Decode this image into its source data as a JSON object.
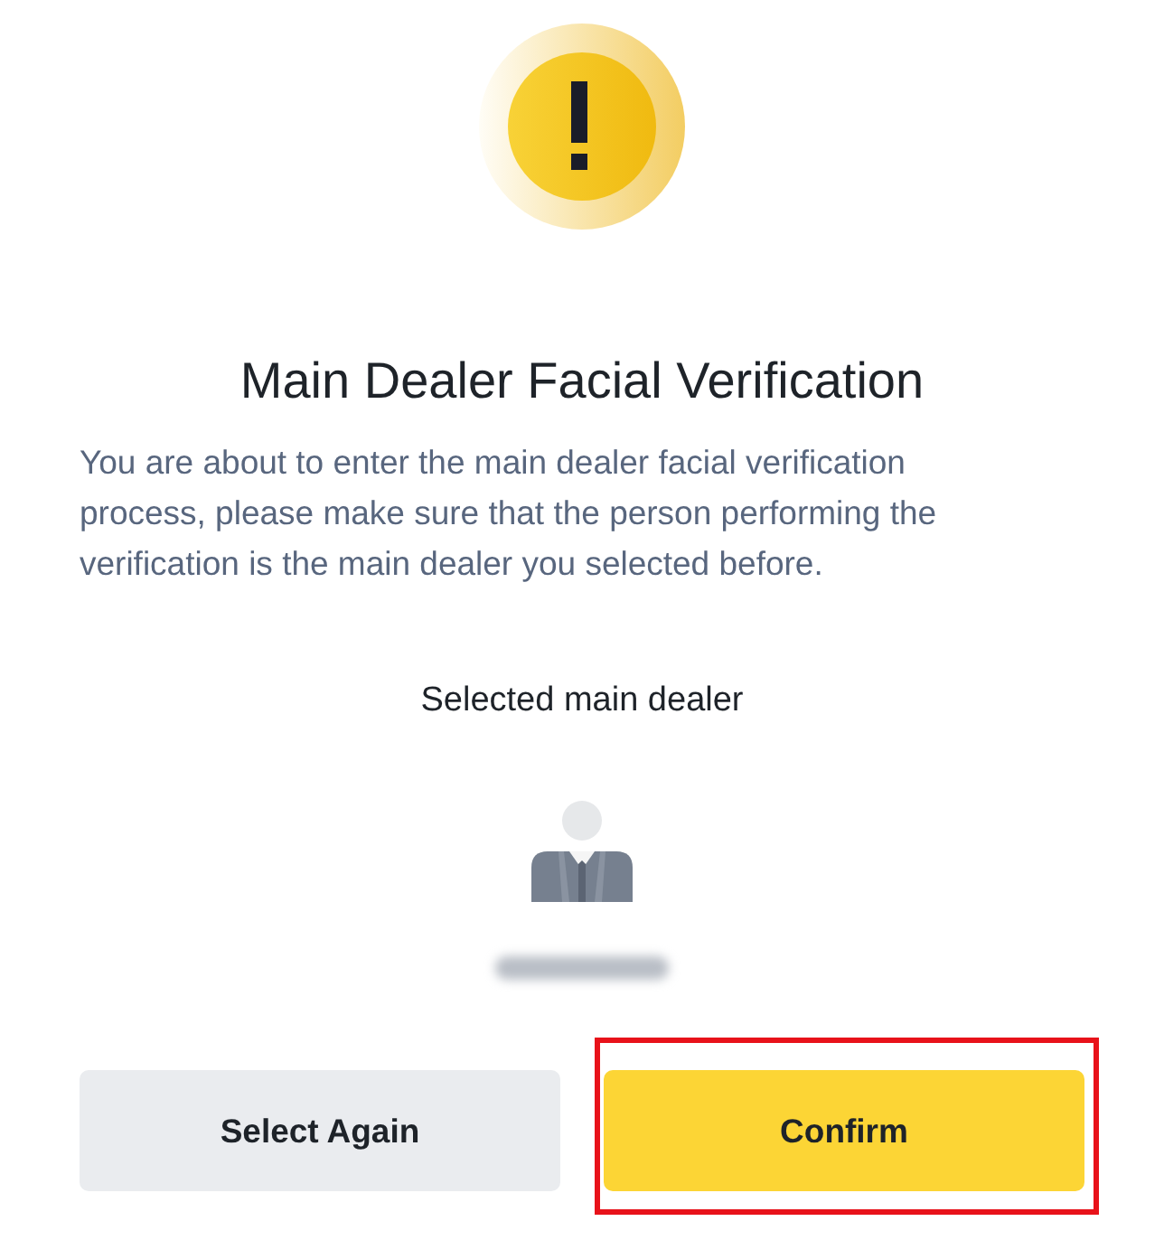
{
  "alert": {
    "title": "Main Dealer Facial Verification",
    "message": "You are about to enter the main dealer facial verification process, please make sure that the person performing the verification is the main dealer you selected before."
  },
  "dealer": {
    "label": "Selected main dealer"
  },
  "buttons": [
    {
      "label": "Select Again",
      "kind": "secondary",
      "highlighted": false
    },
    {
      "label": "Confirm",
      "kind": "primary",
      "highlighted": true
    }
  ]
}
